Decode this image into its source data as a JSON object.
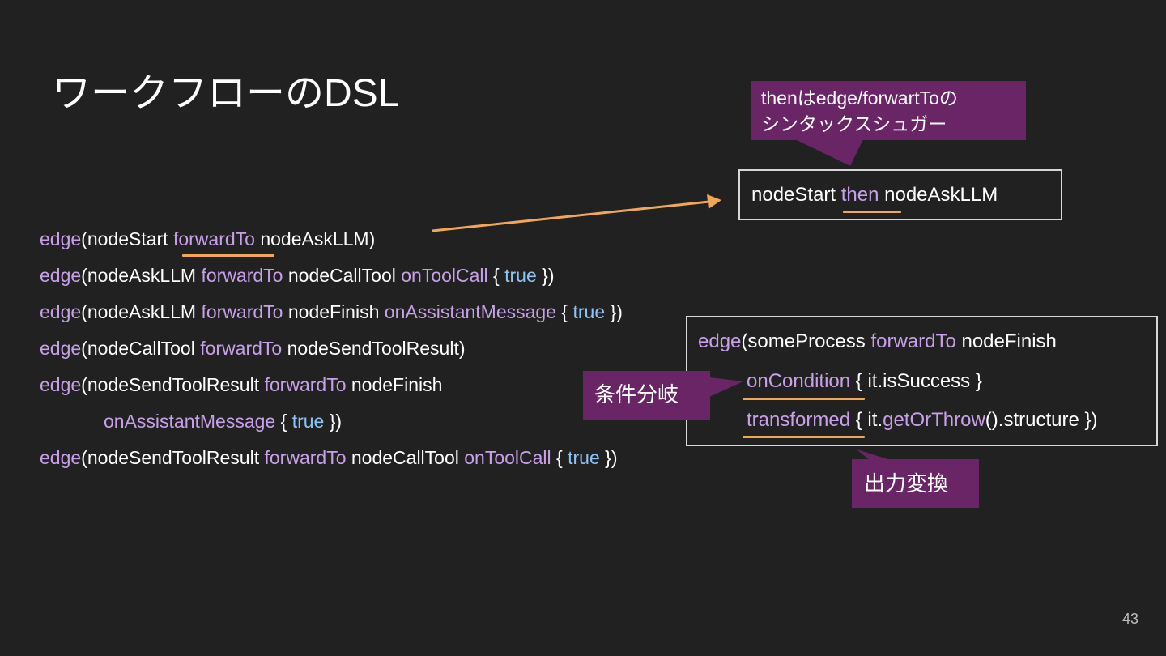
{
  "title": "ワークフローのDSL",
  "page_number": "43",
  "code_lines": [
    [
      {
        "t": "edge",
        "c": "kw"
      },
      {
        "t": "(nodeStart ",
        "c": "plain"
      },
      {
        "t": "forwardTo",
        "c": "kw"
      },
      {
        "t": " nodeAskLLM)",
        "c": "plain"
      }
    ],
    [
      {
        "t": "edge",
        "c": "kw"
      },
      {
        "t": "(nodeAskLLM ",
        "c": "plain"
      },
      {
        "t": "forwardTo",
        "c": "kw"
      },
      {
        "t": " nodeCallTool ",
        "c": "plain"
      },
      {
        "t": "onToolCall",
        "c": "kw"
      },
      {
        "t": " { ",
        "c": "plain"
      },
      {
        "t": "true",
        "c": "lit"
      },
      {
        "t": " })",
        "c": "plain"
      }
    ],
    [
      {
        "t": "edge",
        "c": "kw"
      },
      {
        "t": "(nodeAskLLM ",
        "c": "plain"
      },
      {
        "t": "forwardTo",
        "c": "kw"
      },
      {
        "t": " nodeFinish ",
        "c": "plain"
      },
      {
        "t": "onAssistantMessage",
        "c": "kw"
      },
      {
        "t": " { ",
        "c": "plain"
      },
      {
        "t": "true",
        "c": "lit"
      },
      {
        "t": " })",
        "c": "plain"
      }
    ],
    [
      {
        "t": "edge",
        "c": "kw"
      },
      {
        "t": "(nodeCallTool ",
        "c": "plain"
      },
      {
        "t": "forwardTo",
        "c": "kw"
      },
      {
        "t": " nodeSendToolResult)",
        "c": "plain"
      }
    ],
    [
      {
        "t": "edge",
        "c": "kw"
      },
      {
        "t": "(nodeSendToolResult ",
        "c": "plain"
      },
      {
        "t": "forwardTo",
        "c": "kw"
      },
      {
        "t": " nodeFinish",
        "c": "plain"
      }
    ],
    [
      {
        "t": "onAssistantMessage",
        "c": "kw"
      },
      {
        "t": " { ",
        "c": "plain"
      },
      {
        "t": "true",
        "c": "lit"
      },
      {
        "t": " })",
        "c": "plain"
      }
    ],
    [
      {
        "t": "edge",
        "c": "kw"
      },
      {
        "t": "(nodeSendToolResult ",
        "c": "plain"
      },
      {
        "t": "forwardTo",
        "c": "kw"
      },
      {
        "t": " nodeCallTool ",
        "c": "plain"
      },
      {
        "t": "onToolCall",
        "c": "kw"
      },
      {
        "t": " { ",
        "c": "plain"
      },
      {
        "t": "true",
        "c": "lit"
      },
      {
        "t": " })",
        "c": "plain"
      }
    ]
  ],
  "then_box": [
    {
      "t": "nodeStart ",
      "c": "plain"
    },
    {
      "t": "then",
      "c": "kw"
    },
    {
      "t": " nodeAskLLM",
      "c": "plain"
    }
  ],
  "edge_box_lines": [
    [
      {
        "t": "edge",
        "c": "kw"
      },
      {
        "t": "(someProcess ",
        "c": "plain"
      },
      {
        "t": "forwardTo",
        "c": "kw"
      },
      {
        "t": " nodeFinish",
        "c": "plain"
      }
    ],
    [
      {
        "t": "onCondition",
        "c": "kw"
      },
      {
        "t": " { it.isSuccess }",
        "c": "plain"
      }
    ],
    [
      {
        "t": "transformed",
        "c": "kw"
      },
      {
        "t": " { it.",
        "c": "plain"
      },
      {
        "t": "getOrThrow",
        "c": "kw"
      },
      {
        "t": "().structure })",
        "c": "plain"
      }
    ]
  ],
  "callouts": {
    "then_sugar_line1": "thenはedge/forwartToの",
    "then_sugar_line2": "シンタックスシュガー",
    "condition_branch": "条件分岐",
    "output_transform": "出力変換"
  },
  "colors": {
    "background": "#212121",
    "keyword": "#c7a0e8",
    "literal": "#8ec4f5",
    "callout": "#6a2566",
    "accent_orange": "#f0a858"
  }
}
